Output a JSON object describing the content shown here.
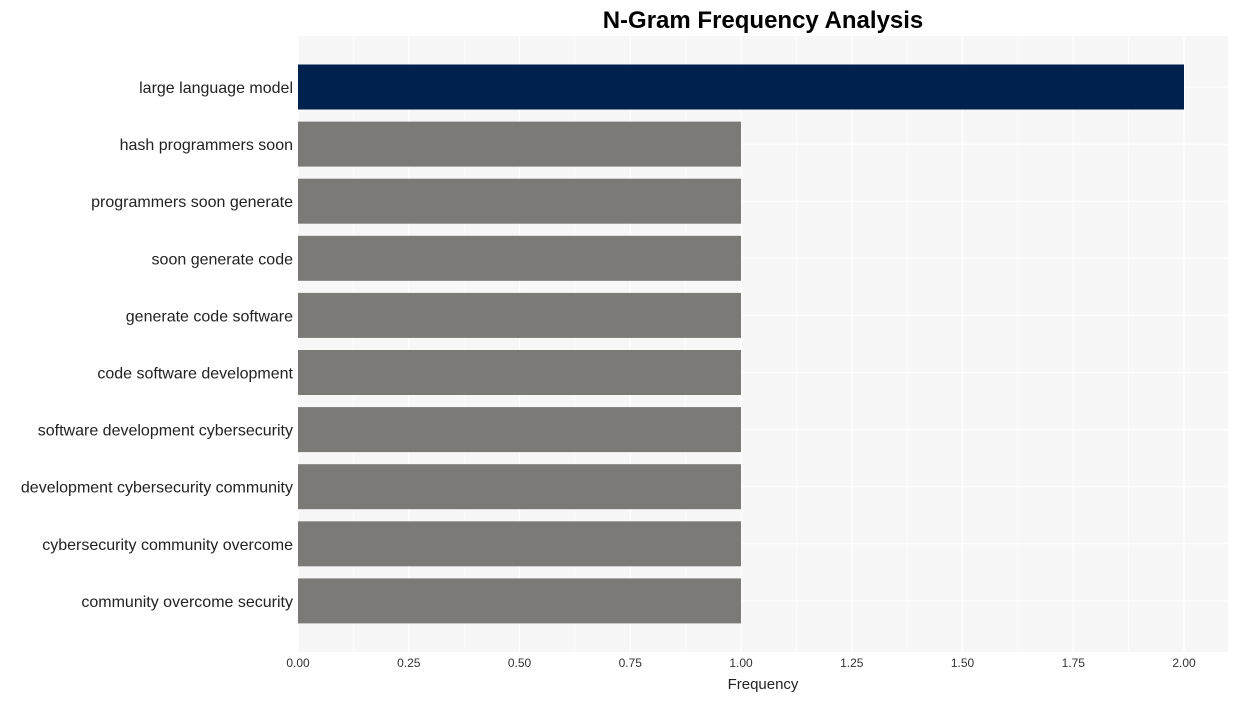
{
  "chart_data": {
    "type": "bar",
    "orientation": "horizontal",
    "title": "N-Gram Frequency Analysis",
    "xlabel": "Frequency",
    "ylabel": "",
    "categories": [
      "large language model",
      "hash programmers soon",
      "programmers soon generate",
      "soon generate code",
      "generate code software",
      "code software development",
      "software development cybersecurity",
      "development cybersecurity community",
      "cybersecurity community overcome",
      "community overcome security"
    ],
    "values": [
      2,
      1,
      1,
      1,
      1,
      1,
      1,
      1,
      1,
      1
    ],
    "xlim": [
      0,
      2.1
    ],
    "xticks": [
      "0.00",
      "0.25",
      "0.50",
      "0.75",
      "1.00",
      "1.25",
      "1.50",
      "1.75",
      "2.00"
    ],
    "grid": true,
    "legend": "none",
    "colors": {
      "highlight": "#00214d",
      "default": "#7b7a76",
      "panel": "#f7f7f7",
      "grid": "#ffffff"
    }
  }
}
